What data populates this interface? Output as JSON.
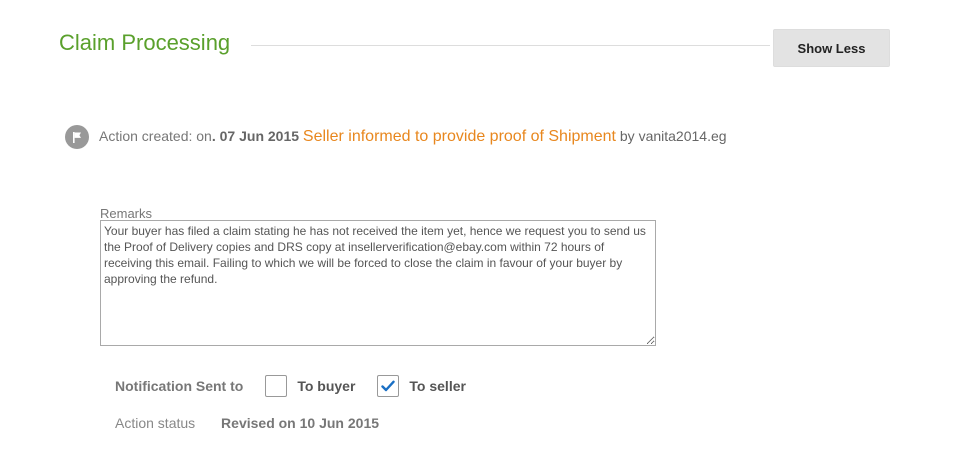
{
  "header": {
    "title": "Claim Processing",
    "toggle_label": "Show Less"
  },
  "action": {
    "prefix": "Action created: on",
    "date": ". 07 Jun 2015",
    "title": "Seller informed to provide proof of Shipment",
    "by_prefix": "by",
    "user": "vanita2014.eg",
    "icon": "flag-icon"
  },
  "remarks": {
    "label": "Remarks",
    "text": "Your buyer has filed a claim stating he has not received the item yet, hence we request you to send us the Proof of Delivery copies and DRS copy at insellerverification@ebay.com within 72 hours of receiving this email. Failing to which we will be forced to close the claim in favour of your buyer by approving the refund."
  },
  "notification": {
    "label": "Notification Sent to",
    "options": [
      {
        "label": "To buyer",
        "checked": false
      },
      {
        "label": "To seller",
        "checked": true
      }
    ]
  },
  "status": {
    "label": "Action status",
    "value": "Revised on 10 Jun 2015"
  },
  "colors": {
    "title": "#5aa02c",
    "action_link": "#e8871e",
    "check": "#1a6fc4"
  }
}
